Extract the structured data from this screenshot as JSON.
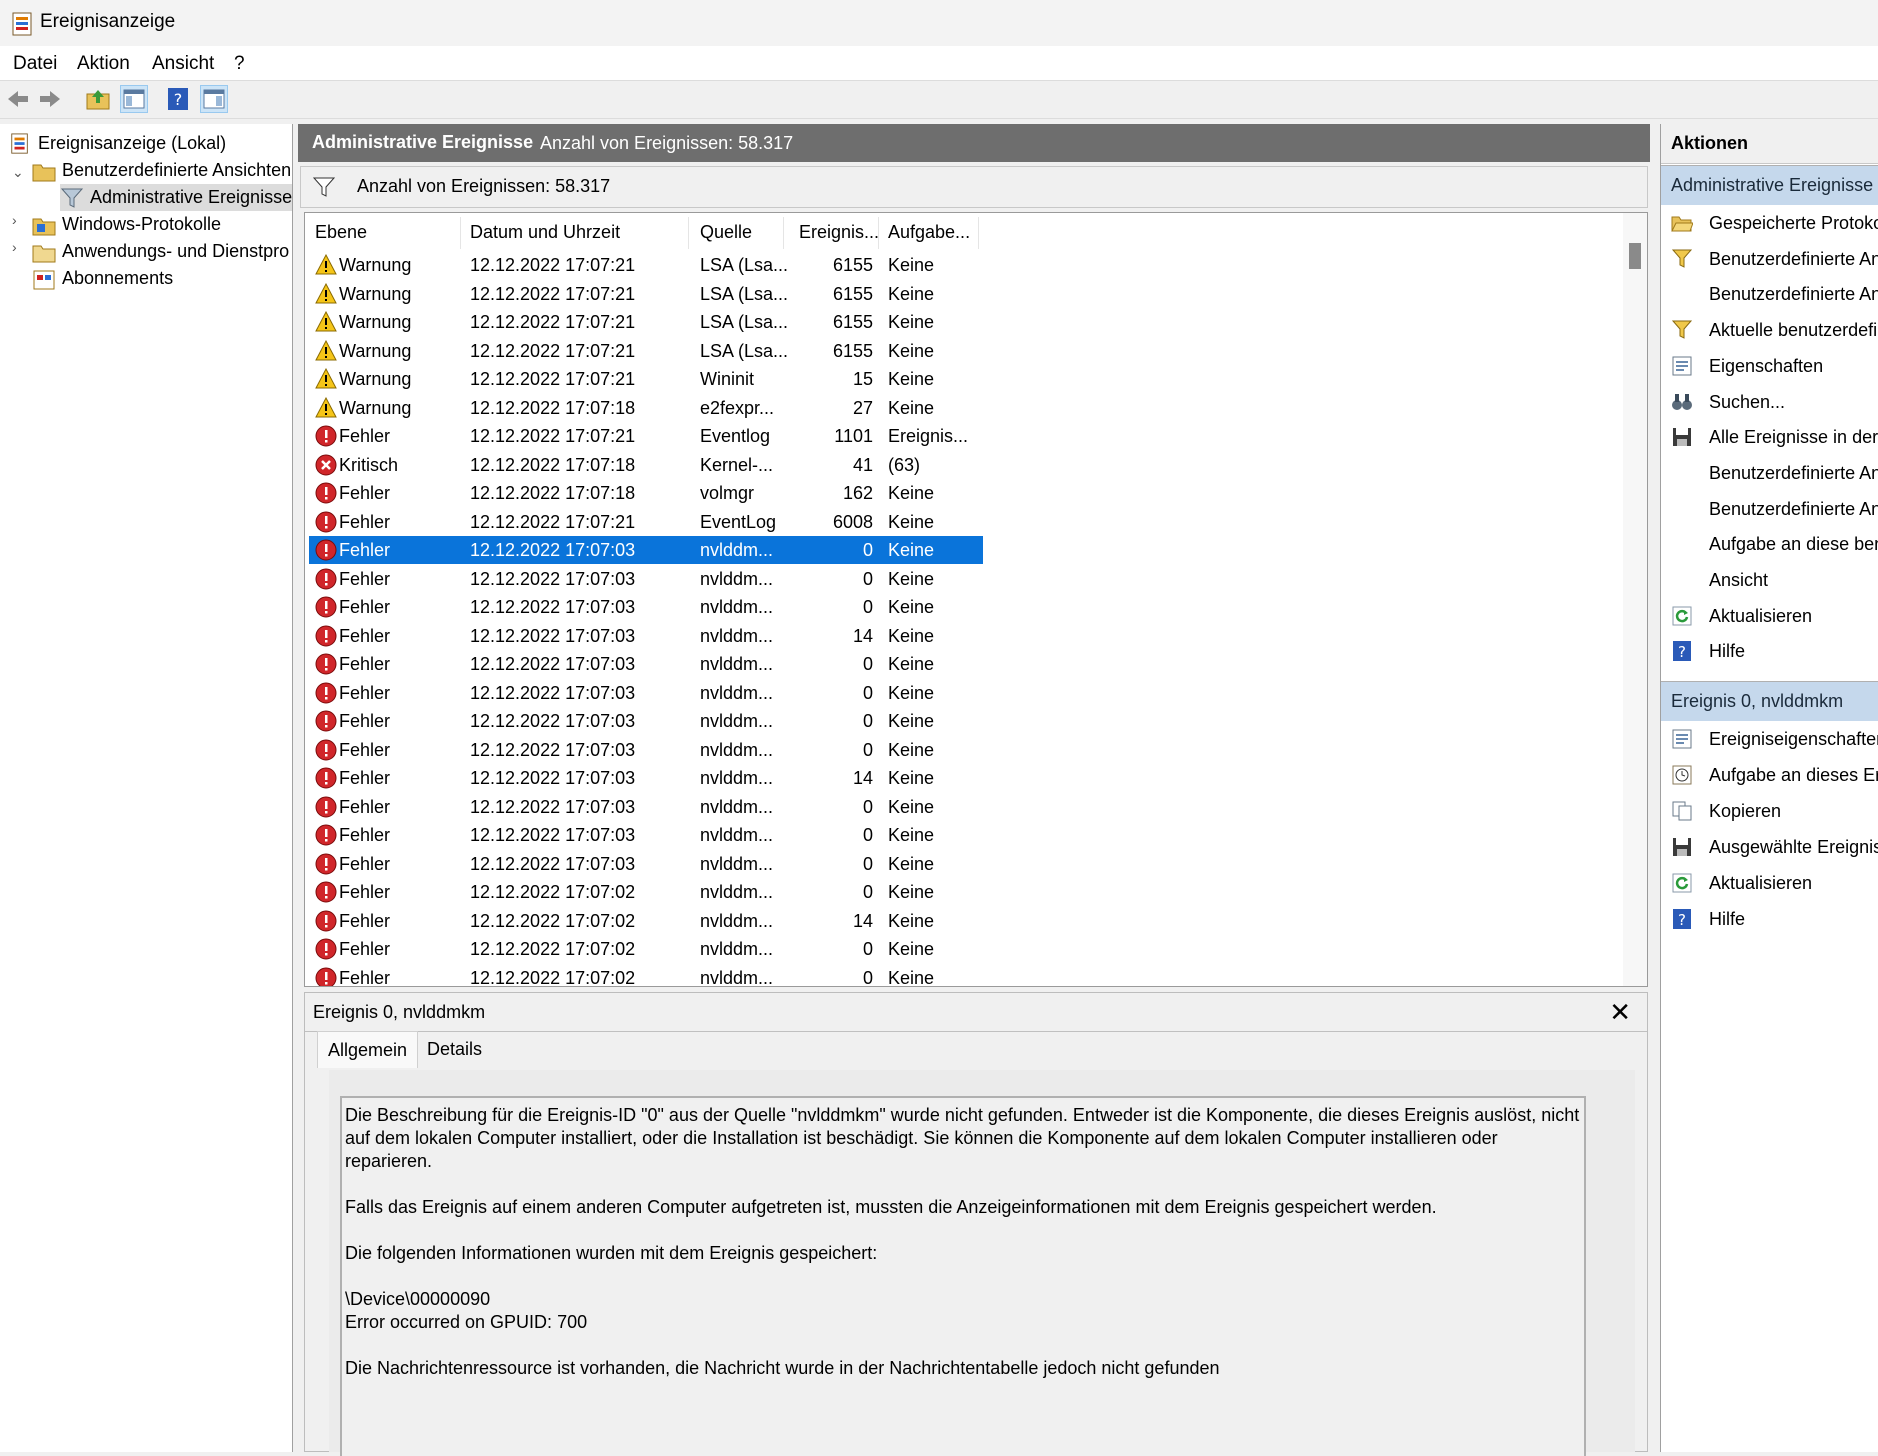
{
  "window": {
    "title": "Ereignisanzeige"
  },
  "menu": [
    "Datei",
    "Aktion",
    "Ansicht",
    "?"
  ],
  "toolbar": [
    "back",
    "forward",
    "up-folder",
    "show-hide-tree",
    "help",
    "show-hide-actions"
  ],
  "tree": {
    "root": "Ereignisanzeige (Lokal)",
    "custom_views": "Benutzerdefinierte Ansichten",
    "admin_events": "Administrative Ereignisse",
    "windows_logs": "Windows-Protokolle",
    "app_service_logs": "Anwendungs- und Dienstpro",
    "subscriptions": "Abonnements"
  },
  "center": {
    "title": "Administrative Ereignisse",
    "count": "Anzahl von Ereignissen: 58.317",
    "filter_text": "Anzahl von Ereignissen: 58.317"
  },
  "columns": [
    "Ebene",
    "Datum und Uhrzeit",
    "Quelle",
    "Ereignis...",
    "Aufgabe..."
  ],
  "events": [
    {
      "level": "Warnung",
      "type": "warning",
      "date": "12.12.2022 17:07:21",
      "source": "LSA (Lsa...",
      "id": "6155",
      "task": "Keine"
    },
    {
      "level": "Warnung",
      "type": "warning",
      "date": "12.12.2022 17:07:21",
      "source": "LSA (Lsa...",
      "id": "6155",
      "task": "Keine"
    },
    {
      "level": "Warnung",
      "type": "warning",
      "date": "12.12.2022 17:07:21",
      "source": "LSA (Lsa...",
      "id": "6155",
      "task": "Keine"
    },
    {
      "level": "Warnung",
      "type": "warning",
      "date": "12.12.2022 17:07:21",
      "source": "LSA (Lsa...",
      "id": "6155",
      "task": "Keine"
    },
    {
      "level": "Warnung",
      "type": "warning",
      "date": "12.12.2022 17:07:21",
      "source": "Wininit",
      "id": "15",
      "task": "Keine"
    },
    {
      "level": "Warnung",
      "type": "warning",
      "date": "12.12.2022 17:07:18",
      "source": "e2fexpr...",
      "id": "27",
      "task": "Keine"
    },
    {
      "level": "Fehler",
      "type": "error",
      "date": "12.12.2022 17:07:21",
      "source": "Eventlog",
      "id": "1101",
      "task": "Ereignis..."
    },
    {
      "level": "Kritisch",
      "type": "critical",
      "date": "12.12.2022 17:07:18",
      "source": "Kernel-...",
      "id": "41",
      "task": "(63)"
    },
    {
      "level": "Fehler",
      "type": "error",
      "date": "12.12.2022 17:07:18",
      "source": "volmgr",
      "id": "162",
      "task": "Keine"
    },
    {
      "level": "Fehler",
      "type": "error",
      "date": "12.12.2022 17:07:21",
      "source": "EventLog",
      "id": "6008",
      "task": "Keine"
    },
    {
      "level": "Fehler",
      "type": "error",
      "date": "12.12.2022 17:07:03",
      "source": "nvlddm...",
      "id": "0",
      "task": "Keine",
      "selected": true
    },
    {
      "level": "Fehler",
      "type": "error",
      "date": "12.12.2022 17:07:03",
      "source": "nvlddm...",
      "id": "0",
      "task": "Keine"
    },
    {
      "level": "Fehler",
      "type": "error",
      "date": "12.12.2022 17:07:03",
      "source": "nvlddm...",
      "id": "0",
      "task": "Keine"
    },
    {
      "level": "Fehler",
      "type": "error",
      "date": "12.12.2022 17:07:03",
      "source": "nvlddm...",
      "id": "14",
      "task": "Keine"
    },
    {
      "level": "Fehler",
      "type": "error",
      "date": "12.12.2022 17:07:03",
      "source": "nvlddm...",
      "id": "0",
      "task": "Keine"
    },
    {
      "level": "Fehler",
      "type": "error",
      "date": "12.12.2022 17:07:03",
      "source": "nvlddm...",
      "id": "0",
      "task": "Keine"
    },
    {
      "level": "Fehler",
      "type": "error",
      "date": "12.12.2022 17:07:03",
      "source": "nvlddm...",
      "id": "0",
      "task": "Keine"
    },
    {
      "level": "Fehler",
      "type": "error",
      "date": "12.12.2022 17:07:03",
      "source": "nvlddm...",
      "id": "0",
      "task": "Keine"
    },
    {
      "level": "Fehler",
      "type": "error",
      "date": "12.12.2022 17:07:03",
      "source": "nvlddm...",
      "id": "14",
      "task": "Keine"
    },
    {
      "level": "Fehler",
      "type": "error",
      "date": "12.12.2022 17:07:03",
      "source": "nvlddm...",
      "id": "0",
      "task": "Keine"
    },
    {
      "level": "Fehler",
      "type": "error",
      "date": "12.12.2022 17:07:03",
      "source": "nvlddm...",
      "id": "0",
      "task": "Keine"
    },
    {
      "level": "Fehler",
      "type": "error",
      "date": "12.12.2022 17:07:03",
      "source": "nvlddm...",
      "id": "0",
      "task": "Keine"
    },
    {
      "level": "Fehler",
      "type": "error",
      "date": "12.12.2022 17:07:02",
      "source": "nvlddm...",
      "id": "0",
      "task": "Keine"
    },
    {
      "level": "Fehler",
      "type": "error",
      "date": "12.12.2022 17:07:02",
      "source": "nvlddm...",
      "id": "14",
      "task": "Keine"
    },
    {
      "level": "Fehler",
      "type": "error",
      "date": "12.12.2022 17:07:02",
      "source": "nvlddm...",
      "id": "0",
      "task": "Keine"
    },
    {
      "level": "Fehler",
      "type": "error",
      "date": "12.12.2022 17:07:02",
      "source": "nvlddm...",
      "id": "0",
      "task": "Keine"
    }
  ],
  "preview": {
    "title": "Ereignis 0, nvlddmkm",
    "close": "✕",
    "tabs": [
      "Allgemein",
      "Details"
    ],
    "text": "Die Beschreibung für die Ereignis-ID \"0\" aus der Quelle \"nvlddmkm\" wurde nicht gefunden. Entweder ist die Komponente, die dieses Ereignis auslöst, nicht\nauf dem lokalen Computer installiert, oder die Installation ist beschädigt. Sie können die Komponente auf dem lokalen Computer installieren oder reparieren.\n\nFalls das Ereignis auf einem anderen Computer aufgetreten ist, mussten die Anzeigeinformationen mit dem Ereignis gespeichert werden.\n\nDie folgenden Informationen wurden mit dem Ereignis gespeichert:\n\n\\Device\\00000090\nError occurred on GPUID: 700\n\nDie Nachrichtenressource ist vorhanden, die Nachricht wurde in der Nachrichtentabelle jedoch nicht gefunden"
  },
  "actions": {
    "header": "Aktionen",
    "section1": "Administrative Ereignisse",
    "items1": [
      {
        "label": "Gespeicherte Protokol",
        "icon": "folder-open-icon"
      },
      {
        "label": "Benutzerdefinierte An",
        "icon": "filter-icon"
      },
      {
        "label": "Benutzerdefinierte An",
        "icon": ""
      },
      {
        "label": "Aktuelle benutzerdefi",
        "icon": "filter-icon"
      },
      {
        "label": "Eigenschaften",
        "icon": "properties-icon"
      },
      {
        "label": "Suchen...",
        "icon": "binoculars-icon"
      },
      {
        "label": "Alle Ereignisse in der b",
        "icon": "save-icon"
      },
      {
        "label": "Benutzerdefinierte An",
        "icon": ""
      },
      {
        "label": "Benutzerdefinierte An",
        "icon": ""
      },
      {
        "label": "Aufgabe an diese ben",
        "icon": ""
      },
      {
        "label": "Ansicht",
        "icon": ""
      },
      {
        "label": "Aktualisieren",
        "icon": "refresh-icon"
      },
      {
        "label": "Hilfe",
        "icon": "help-icon"
      }
    ],
    "section2": "Ereignis 0, nvlddmkm",
    "items2": [
      {
        "label": "Ereigniseigenschaften",
        "icon": "properties-icon"
      },
      {
        "label": "Aufgabe an dieses Ere",
        "icon": "task-clock-icon"
      },
      {
        "label": "Kopieren",
        "icon": "copy-icon"
      },
      {
        "label": "Ausgewählte Ereigniss",
        "icon": "save-icon"
      },
      {
        "label": "Aktualisieren",
        "icon": "refresh-icon"
      },
      {
        "label": "Hilfe",
        "icon": "help-icon"
      }
    ]
  }
}
